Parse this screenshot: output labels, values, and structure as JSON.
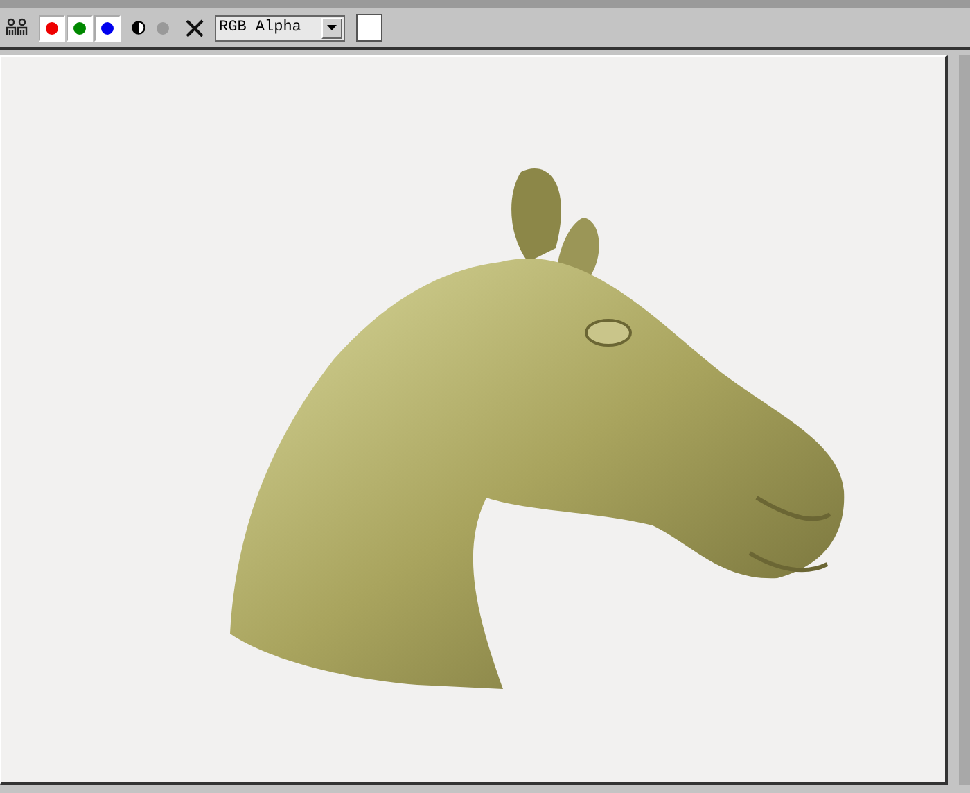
{
  "toolbar": {
    "channels": [
      {
        "on": true,
        "color": "#ee0000"
      },
      {
        "on": true,
        "color": "#008800"
      },
      {
        "on": true,
        "color": "#0000ee"
      }
    ],
    "monochrome": {
      "on": false
    },
    "channel_display": {
      "value": "RGB Alpha"
    },
    "color_swatch": {
      "color": "#ffffff"
    }
  }
}
